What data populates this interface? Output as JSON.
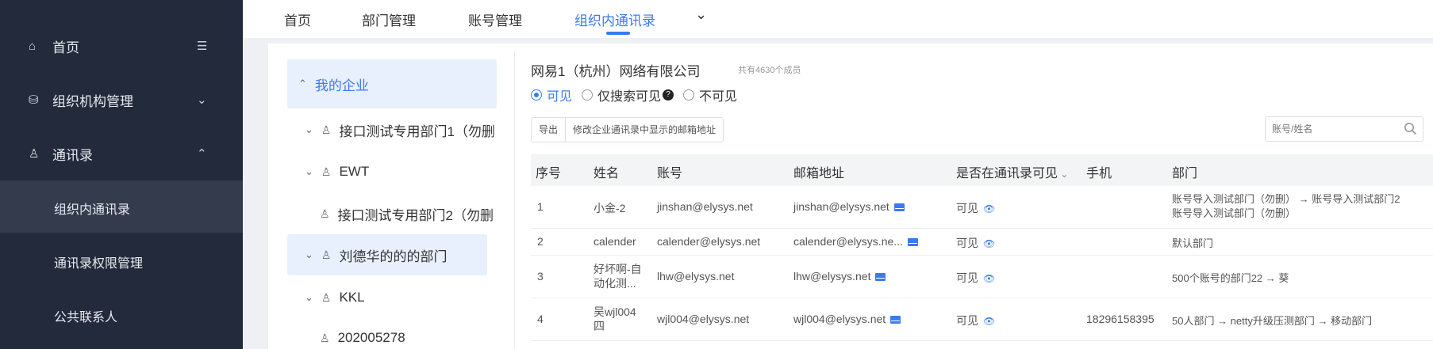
{
  "sidebar": {
    "items": [
      {
        "label": "首页",
        "icon": "home-icon",
        "right": "☰"
      },
      {
        "label": "组织机构管理",
        "icon": "org-icon",
        "right": "⌄"
      },
      {
        "label": "通讯录",
        "icon": "contacts-icon",
        "right": "⌃"
      }
    ],
    "subitems": [
      {
        "label": "组织内通讯录",
        "active": true
      },
      {
        "label": "通讯录权限管理"
      },
      {
        "label": "公共联系人"
      }
    ]
  },
  "tabs": [
    {
      "label": "首页"
    },
    {
      "label": "部门管理"
    },
    {
      "label": "账号管理"
    },
    {
      "label": "组织内通讯录",
      "active": true
    }
  ],
  "tab_more": "⌄",
  "tree": {
    "root": "我的企业",
    "nodes": [
      {
        "label": "接口测试专用部门1（勿删",
        "chevron": "⌄"
      },
      {
        "label": "EWT",
        "chevron": "⌄"
      },
      {
        "label": "接口测试专用部门2（勿删",
        "chevron": ""
      },
      {
        "label": "刘德华的的的部门",
        "chevron": "⌄"
      },
      {
        "label": "KKL",
        "chevron": "⌄"
      },
      {
        "label": "202005278",
        "chevron": ""
      }
    ]
  },
  "main": {
    "company_name": "网易1（杭州）网络有限公司",
    "member_count": "共有4630个成员",
    "visibility": {
      "visible": "可见",
      "search_only": "仅搜索可见",
      "invisible": "不可见",
      "help": "?"
    },
    "buttons": {
      "export": "导出",
      "edit_email": "修改企业通讯录中显示的邮箱地址"
    },
    "search_placeholder": "账号/姓名",
    "table": {
      "headers": {
        "index": "序号",
        "name": "姓名",
        "account": "账号",
        "email": "邮箱地址",
        "visible": "是否在通讯录可见",
        "phone": "手机",
        "dept": "部门"
      },
      "rows": [
        {
          "index": "1",
          "name": "小金-2",
          "account": "jinshan@elysys.net",
          "email": "jinshan@elysys.net",
          "visible": "可见",
          "phone": "",
          "dept": "账号导入测试部门（勿删） → 账号导入测试部门2",
          "dept2": "账号导入测试部门（勿删）"
        },
        {
          "index": "2",
          "name": "calender",
          "account": "calender@elysys.net",
          "email": "calender@elysys.ne...",
          "visible": "可见",
          "phone": "",
          "dept": "默认部门",
          "dept2": ""
        },
        {
          "index": "3",
          "name": "好坏啊-自动化测...",
          "account": "lhw@elysys.net",
          "email": "lhw@elysys.net",
          "visible": "可见",
          "phone": "",
          "dept": "500个账号的部门22 → 葵",
          "dept2": ""
        },
        {
          "index": "4",
          "name": "吴wjl004四",
          "account": "wjl004@elysys.net",
          "email": "wjl004@elysys.net",
          "visible": "可见",
          "phone": "18296158395",
          "dept": "50人部门 → netty升级压测部门 → 移动部门",
          "dept2": ""
        }
      ]
    }
  },
  "colors": {
    "sidebar_bg": "#232a3b",
    "sidebar_active": "#333b4d",
    "accent": "#3a7af2"
  }
}
